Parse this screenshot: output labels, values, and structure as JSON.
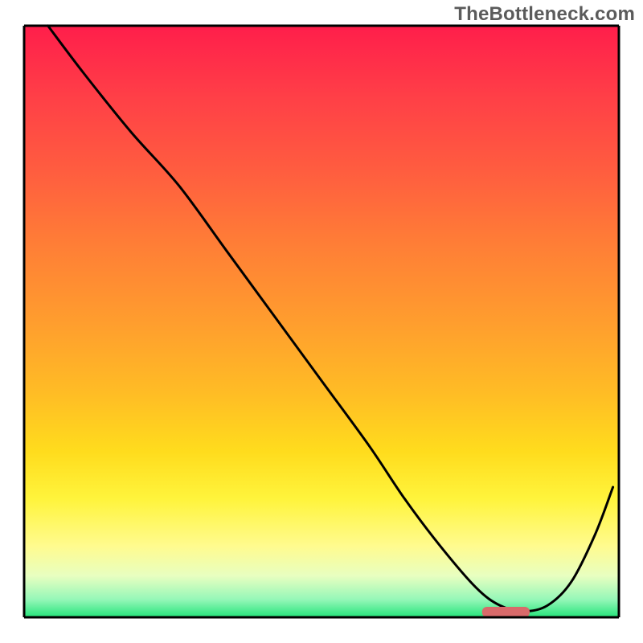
{
  "watermark": "TheBottleneck.com",
  "chart_data": {
    "type": "line",
    "title": "",
    "xlabel": "",
    "ylabel": "",
    "xlim": [
      0,
      100
    ],
    "ylim": [
      0,
      100
    ],
    "grid": false,
    "annotations": [],
    "x": [
      4,
      10,
      18,
      26,
      34,
      42,
      50,
      58,
      64,
      70,
      76,
      80,
      84,
      88,
      92,
      96,
      99
    ],
    "values": [
      100,
      92,
      82,
      73,
      62,
      51,
      40,
      29,
      20,
      12,
      5,
      2,
      1,
      2,
      6,
      14,
      22
    ],
    "gradient_bands": [
      {
        "color": "#ff1e4b",
        "stop": 0.0
      },
      {
        "color": "#ff3f47",
        "stop": 0.12
      },
      {
        "color": "#ff5e3f",
        "stop": 0.25
      },
      {
        "color": "#ff7e36",
        "stop": 0.37
      },
      {
        "color": "#ff9d2e",
        "stop": 0.5
      },
      {
        "color": "#ffbc25",
        "stop": 0.62
      },
      {
        "color": "#ffdc1d",
        "stop": 0.72
      },
      {
        "color": "#fff43c",
        "stop": 0.8
      },
      {
        "color": "#fffb8f",
        "stop": 0.88
      },
      {
        "color": "#e8ffc0",
        "stop": 0.93
      },
      {
        "color": "#95f7b8",
        "stop": 0.97
      },
      {
        "color": "#25e47a",
        "stop": 1.0
      }
    ],
    "bottom_marker": {
      "x_start": 77,
      "x_end": 85,
      "y": 0
    }
  }
}
